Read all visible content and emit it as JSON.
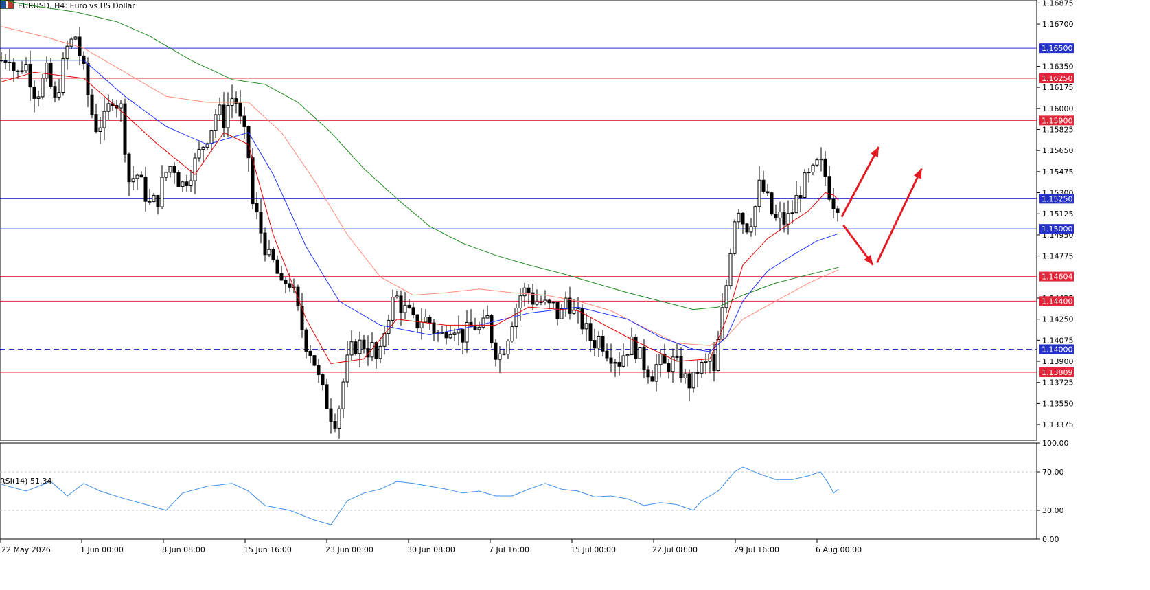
{
  "window": {
    "symbol_title": "EURUSD, H4:  Euro vs US Dollar"
  },
  "colors": {
    "resistance": "#e3263a",
    "support": "#2633c9",
    "ema_fast": "#e00000",
    "ema_mid": "#1f33ff",
    "ema_slow": "#ff8a7a",
    "ema_long": "#1e8a1e",
    "rsi": "#3d8fe6",
    "arrow": "#e31b23"
  },
  "chart_data": {
    "type": "candlestick",
    "price_axis": {
      "ylim": [
        1.1325,
        1.169
      ],
      "ticks": [
        "1.16875",
        "1.16700",
        "1.16350",
        "1.16175",
        "1.16000",
        "1.15825",
        "1.15650",
        "1.15475",
        "1.15300",
        "1.15125",
        "1.14950",
        "1.14775",
        "1.14425",
        "1.14250",
        "1.14075",
        "1.13900",
        "1.13725",
        "1.13550",
        "1.13375"
      ]
    },
    "time_axis": {
      "labels": [
        "22 May 2026",
        "1 Jun 00:00",
        "8 Jun 08:00",
        "15 Jun 16:00",
        "23 Jun 00:00",
        "30 Jun 08:00",
        "7 Jul 16:00",
        "15 Jul 00:00",
        "22 Jul 08:00",
        "29 Jul 16:00",
        "6 Aug 00:00"
      ]
    },
    "horizontal_levels": [
      {
        "label": "1.16500",
        "value": 1.165,
        "role": "support",
        "dashed": false
      },
      {
        "label": "1.16250",
        "value": 1.1625,
        "role": "resistance",
        "dashed": false
      },
      {
        "label": "1.15900",
        "value": 1.159,
        "role": "resistance",
        "dashed": false
      },
      {
        "label": "1.15250",
        "value": 1.1525,
        "role": "support",
        "dashed": false
      },
      {
        "label": "1.15000",
        "value": 1.15,
        "role": "support",
        "dashed": false
      },
      {
        "label": "1.14604",
        "value": 1.14604,
        "role": "resistance",
        "dashed": false
      },
      {
        "label": "1.14400",
        "value": 1.144,
        "role": "resistance",
        "dashed": false
      },
      {
        "label": "1.14000",
        "value": 1.14,
        "role": "support",
        "dashed": true
      },
      {
        "label": "1.13809",
        "value": 1.13809,
        "role": "resistance",
        "dashed": false
      }
    ],
    "close_path": [
      [
        0,
        1.164
      ],
      [
        10,
        1.1645
      ],
      [
        18,
        1.1625
      ],
      [
        28,
        1.164
      ],
      [
        42,
        1.161
      ],
      [
        55,
        1.163
      ],
      [
        65,
        1.1605
      ],
      [
        80,
        1.165
      ],
      [
        90,
        1.166
      ],
      [
        100,
        1.163
      ],
      [
        108,
        1.16
      ],
      [
        115,
        1.1585
      ],
      [
        125,
        1.159
      ],
      [
        135,
        1.161
      ],
      [
        145,
        1.16
      ],
      [
        155,
        1.154
      ],
      [
        165,
        1.1545
      ],
      [
        180,
        1.152
      ],
      [
        190,
        1.1525
      ],
      [
        198,
        1.1545
      ],
      [
        208,
        1.1555
      ],
      [
        218,
        1.1535
      ],
      [
        228,
        1.1545
      ],
      [
        235,
        1.1555
      ],
      [
        245,
        1.157
      ],
      [
        255,
        1.1585
      ],
      [
        262,
        1.16
      ],
      [
        270,
        1.159
      ],
      [
        278,
        1.161
      ],
      [
        286,
        1.1605
      ],
      [
        291,
        1.1585
      ],
      [
        296,
        1.1575
      ],
      [
        300,
        1.156
      ],
      [
        305,
        1.152
      ],
      [
        310,
        1.151
      ],
      [
        318,
        1.149
      ],
      [
        325,
        1.1475
      ],
      [
        332,
        1.147
      ],
      [
        340,
        1.145
      ],
      [
        348,
        1.146
      ],
      [
        355,
        1.1445
      ],
      [
        362,
        1.1425
      ],
      [
        370,
        1.1405
      ],
      [
        378,
        1.1395
      ],
      [
        385,
        1.1375
      ],
      [
        392,
        1.136
      ],
      [
        398,
        1.135
      ],
      [
        403,
        1.134
      ],
      [
        408,
        1.1345
      ],
      [
        413,
        1.1365
      ],
      [
        418,
        1.1385
      ],
      [
        423,
        1.1395
      ],
      [
        428,
        1.1405
      ],
      [
        433,
        1.14
      ],
      [
        438,
        1.141
      ],
      [
        443,
        1.1395
      ],
      [
        448,
        1.1405
      ],
      [
        453,
        1.1395
      ],
      [
        458,
        1.1385
      ],
      [
        463,
        1.141
      ],
      [
        470,
        1.143
      ],
      [
        478,
        1.1445
      ],
      [
        486,
        1.1435
      ],
      [
        494,
        1.143
      ],
      [
        502,
        1.142
      ],
      [
        510,
        1.1425
      ],
      [
        518,
        1.1425
      ],
      [
        526,
        1.1415
      ],
      [
        534,
        1.141
      ],
      [
        542,
        1.142
      ],
      [
        550,
        1.142
      ],
      [
        558,
        1.141
      ],
      [
        566,
        1.1415
      ],
      [
        574,
        1.142
      ],
      [
        582,
        1.1415
      ],
      [
        590,
        1.1425
      ],
      [
        598,
        1.14
      ],
      [
        606,
        1.1395
      ],
      [
        614,
        1.141
      ],
      [
        622,
        1.143
      ],
      [
        630,
        1.1445
      ],
      [
        638,
        1.145
      ],
      [
        646,
        1.144
      ],
      [
        654,
        1.144
      ],
      [
        662,
        1.1435
      ],
      [
        670,
        1.1435
      ],
      [
        678,
        1.1425
      ],
      [
        686,
        1.1445
      ],
      [
        694,
        1.143
      ],
      [
        702,
        1.1425
      ],
      [
        710,
        1.1415
      ],
      [
        718,
        1.1405
      ],
      [
        726,
        1.141
      ],
      [
        734,
        1.14
      ],
      [
        742,
        1.1395
      ],
      [
        750,
        1.139
      ],
      [
        758,
        1.14
      ],
      [
        766,
        1.1405
      ],
      [
        774,
        1.1395
      ],
      [
        782,
        1.1385
      ],
      [
        790,
        1.138
      ],
      [
        798,
        1.139
      ],
      [
        806,
        1.1385
      ],
      [
        814,
        1.139
      ],
      [
        822,
        1.1385
      ],
      [
        830,
        1.1375
      ],
      [
        838,
        1.137
      ],
      [
        846,
        1.1385
      ],
      [
        854,
        1.1385
      ],
      [
        860,
        1.1395
      ],
      [
        866,
        1.1375
      ],
      [
        872,
        1.142
      ],
      [
        878,
        1.144
      ],
      [
        884,
        1.148
      ],
      [
        890,
        1.151
      ],
      [
        896,
        1.152
      ],
      [
        902,
        1.15
      ],
      [
        908,
        1.1505
      ],
      [
        914,
        1.1515
      ],
      [
        920,
        1.1535
      ],
      [
        926,
        1.153
      ],
      [
        932,
        1.152
      ],
      [
        938,
        1.1505
      ],
      [
        944,
        1.151
      ],
      [
        952,
        1.1505
      ],
      [
        960,
        1.1515
      ],
      [
        968,
        1.153
      ],
      [
        976,
        1.154
      ],
      [
        984,
        1.1545
      ],
      [
        992,
        1.1555
      ],
      [
        998,
        1.155
      ],
      [
        1003,
        1.1535
      ],
      [
        1008,
        1.1525
      ],
      [
        1012,
        1.152
      ],
      [
        1016,
        1.1522
      ]
    ],
    "ema_fast": [
      [
        0,
        1.1622
      ],
      [
        40,
        1.163
      ],
      [
        100,
        1.1625
      ],
      [
        150,
        1.1595
      ],
      [
        190,
        1.157
      ],
      [
        235,
        1.1545
      ],
      [
        270,
        1.158
      ],
      [
        300,
        1.157
      ],
      [
        330,
        1.1495
      ],
      [
        370,
        1.1425
      ],
      [
        400,
        1.1388
      ],
      [
        440,
        1.1392
      ],
      [
        480,
        1.1425
      ],
      [
        540,
        1.142
      ],
      [
        600,
        1.142
      ],
      [
        640,
        1.1435
      ],
      [
        700,
        1.1432
      ],
      [
        760,
        1.141
      ],
      [
        820,
        1.139
      ],
      [
        860,
        1.1392
      ],
      [
        880,
        1.1425
      ],
      [
        900,
        1.147
      ],
      [
        930,
        1.1492
      ],
      [
        980,
        1.1515
      ],
      [
        1000,
        1.153
      ],
      [
        1010,
        1.1528
      ],
      [
        1016,
        1.1524
      ]
    ],
    "ema_mid": [
      [
        0,
        1.164
      ],
      [
        50,
        1.164
      ],
      [
        100,
        1.164
      ],
      [
        150,
        1.161
      ],
      [
        200,
        1.1585
      ],
      [
        250,
        1.157
      ],
      [
        300,
        1.158
      ],
      [
        330,
        1.1545
      ],
      [
        370,
        1.1485
      ],
      [
        410,
        1.144
      ],
      [
        460,
        1.142
      ],
      [
        520,
        1.1412
      ],
      [
        580,
        1.142
      ],
      [
        640,
        1.143
      ],
      [
        700,
        1.1435
      ],
      [
        760,
        1.1425
      ],
      [
        800,
        1.141
      ],
      [
        840,
        1.14
      ],
      [
        860,
        1.1398
      ],
      [
        880,
        1.141
      ],
      [
        900,
        1.144
      ],
      [
        930,
        1.1465
      ],
      [
        960,
        1.1478
      ],
      [
        990,
        1.149
      ],
      [
        1016,
        1.1496
      ]
    ],
    "ema_slow": [
      [
        0,
        1.1668
      ],
      [
        50,
        1.166
      ],
      [
        100,
        1.165
      ],
      [
        150,
        1.163
      ],
      [
        200,
        1.161
      ],
      [
        250,
        1.1605
      ],
      [
        300,
        1.1605
      ],
      [
        340,
        1.158
      ],
      [
        380,
        1.154
      ],
      [
        420,
        1.1495
      ],
      [
        460,
        1.146
      ],
      [
        500,
        1.1445
      ],
      [
        540,
        1.1447
      ],
      [
        580,
        1.145
      ],
      [
        620,
        1.1447
      ],
      [
        660,
        1.1445
      ],
      [
        700,
        1.144
      ],
      [
        740,
        1.1432
      ],
      [
        780,
        1.1418
      ],
      [
        820,
        1.1405
      ],
      [
        860,
        1.1403
      ],
      [
        880,
        1.141
      ],
      [
        900,
        1.1425
      ],
      [
        940,
        1.144
      ],
      [
        980,
        1.1455
      ],
      [
        1016,
        1.1466
      ]
    ],
    "ema_long": [
      [
        0,
        1.169
      ],
      [
        40,
        1.1685
      ],
      [
        90,
        1.168
      ],
      [
        140,
        1.1672
      ],
      [
        180,
        1.166
      ],
      [
        230,
        1.164
      ],
      [
        280,
        1.1624
      ],
      [
        320,
        1.162
      ],
      [
        360,
        1.1605
      ],
      [
        400,
        1.158
      ],
      [
        440,
        1.155
      ],
      [
        480,
        1.1525
      ],
      [
        520,
        1.1502
      ],
      [
        560,
        1.1488
      ],
      [
        600,
        1.1478
      ],
      [
        640,
        1.147
      ],
      [
        680,
        1.1463
      ],
      [
        720,
        1.1455
      ],
      [
        760,
        1.1447
      ],
      [
        800,
        1.144
      ],
      [
        840,
        1.1433
      ],
      [
        870,
        1.1435
      ],
      [
        900,
        1.1445
      ],
      [
        940,
        1.1455
      ],
      [
        980,
        1.1462
      ],
      [
        1016,
        1.1468
      ]
    ],
    "rsi": {
      "label": "RSI(14) 51.34",
      "ylim": [
        0,
        100
      ],
      "ticks": [
        "100.00",
        "70.00",
        "30.00",
        "0.00"
      ],
      "levels": [
        70,
        30
      ],
      "points": [
        [
          0,
          57
        ],
        [
          30,
          50
        ],
        [
          60,
          60
        ],
        [
          80,
          45
        ],
        [
          100,
          58
        ],
        [
          120,
          50
        ],
        [
          150,
          42
        ],
        [
          180,
          35
        ],
        [
          200,
          30
        ],
        [
          220,
          48
        ],
        [
          250,
          55
        ],
        [
          280,
          58
        ],
        [
          300,
          50
        ],
        [
          320,
          35
        ],
        [
          350,
          30
        ],
        [
          380,
          20
        ],
        [
          400,
          15
        ],
        [
          420,
          40
        ],
        [
          440,
          48
        ],
        [
          460,
          52
        ],
        [
          480,
          60
        ],
        [
          500,
          58
        ],
        [
          520,
          55
        ],
        [
          540,
          52
        ],
        [
          560,
          48
        ],
        [
          580,
          50
        ],
        [
          600,
          45
        ],
        [
          620,
          45
        ],
        [
          640,
          52
        ],
        [
          660,
          58
        ],
        [
          680,
          52
        ],
        [
          700,
          50
        ],
        [
          720,
          44
        ],
        [
          740,
          45
        ],
        [
          760,
          42
        ],
        [
          780,
          35
        ],
        [
          800,
          38
        ],
        [
          820,
          36
        ],
        [
          840,
          30
        ],
        [
          850,
          40
        ],
        [
          870,
          50
        ],
        [
          890,
          70
        ],
        [
          900,
          75
        ],
        [
          920,
          68
        ],
        [
          940,
          62
        ],
        [
          960,
          62
        ],
        [
          980,
          66
        ],
        [
          994,
          70
        ],
        [
          1004,
          58
        ],
        [
          1010,
          48
        ],
        [
          1016,
          52
        ]
      ]
    },
    "annotations": [
      {
        "type": "arrow",
        "from": [
          1020,
          1.151
        ],
        "to": [
          1065,
          1.1568
        ]
      },
      {
        "type": "arrow",
        "from": [
          1022,
          1.1503
        ],
        "to": [
          1058,
          1.147
        ]
      },
      {
        "type": "arrow",
        "from": [
          1063,
          1.1472
        ],
        "to": [
          1117,
          1.155
        ]
      }
    ]
  }
}
